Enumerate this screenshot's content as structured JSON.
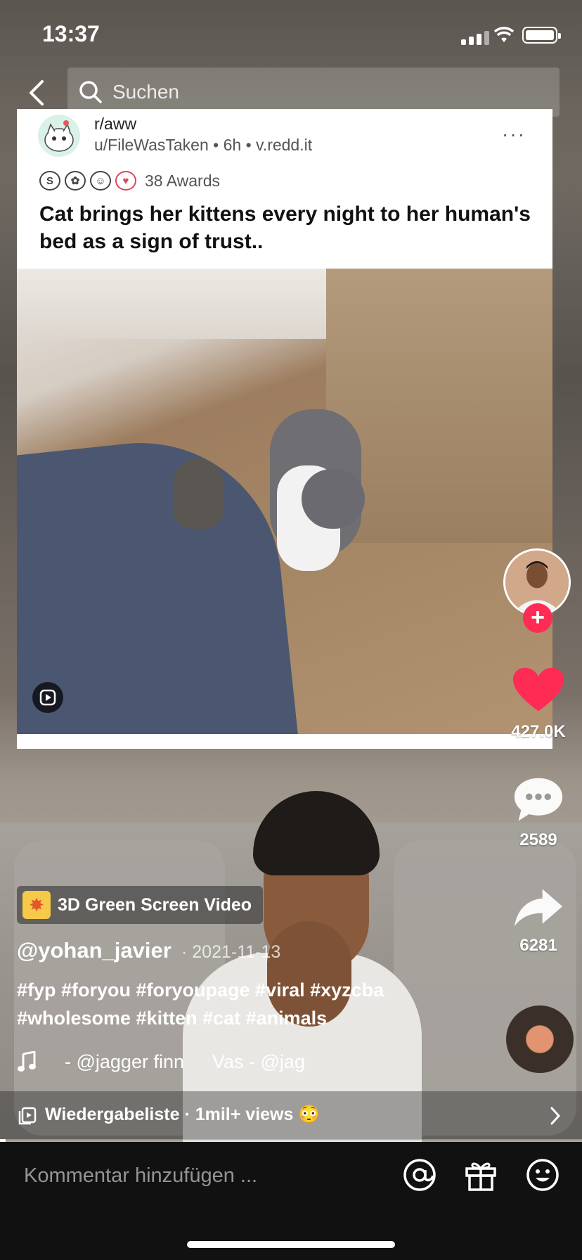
{
  "status": {
    "time": "13:37"
  },
  "search": {
    "placeholder": "Suchen"
  },
  "reddit": {
    "subreddit": "r/aww",
    "meta": "u/FileWasTaken • 6h • v.redd.it",
    "more": "···",
    "awards_count": "38 Awards",
    "title": "Cat brings her kittens every night to her human's bed as a sign of trust.."
  },
  "rail": {
    "likes": "427.0K",
    "comments": "2589",
    "shares": "6281",
    "follow_symbol": "+"
  },
  "caption": {
    "effect": "3D Green Screen Video",
    "username": "@yohan_javier",
    "date": "· 2021-11-13",
    "hashtags": "#fyp #foryou #foryoupage #viral #xyzcba #wholesome #kitten #cat #animals",
    "music_a": "- @jagger finn",
    "music_b": "Vas - @jag"
  },
  "playlist": {
    "label": "Wiedergabeliste · 1mil+ views 😳"
  },
  "progress": {
    "fraction": 0.01
  },
  "comment": {
    "placeholder": "Kommentar hinzufügen ..."
  },
  "colors": {
    "accent": "#fe2c55",
    "heart": "#fe2c55"
  }
}
